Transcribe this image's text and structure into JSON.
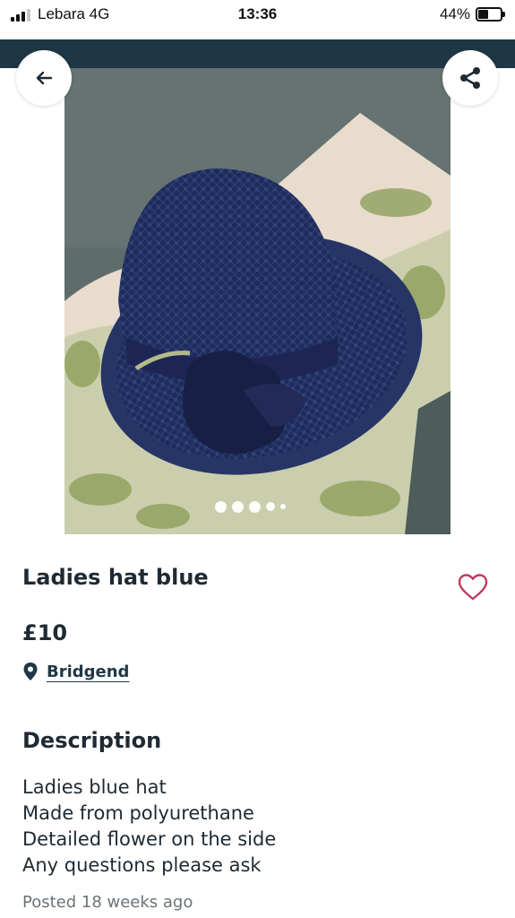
{
  "status_bar": {
    "carrier": "Lebara  4G",
    "time": "13:36",
    "battery_percent": "44%"
  },
  "gallery": {
    "image_description_icon": "photo-of-navy-blue-straw-hat",
    "image_count": 5,
    "active_index": 0
  },
  "listing": {
    "title": "Ladies hat blue",
    "price": "£10",
    "location": "Bridgend",
    "description_heading": "Description",
    "description_lines": [
      "Ladies blue hat",
      "Made from polyurethane",
      "Detailed flower on the side",
      "Any questions please ask"
    ],
    "posted": "Posted 18 weeks ago"
  },
  "colors": {
    "header": "#1f3744",
    "accent_heart": "#c03a5f",
    "text": "#1f2a33",
    "muted": "#6b7378"
  }
}
